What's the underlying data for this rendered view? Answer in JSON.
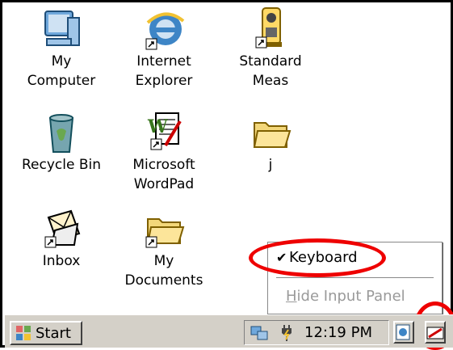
{
  "desktop": {
    "icons": [
      {
        "label": "My\nComputer"
      },
      {
        "label": "Internet\nExplorer"
      },
      {
        "label": "Standard\nMeas"
      },
      {
        "label": "Recycle Bin"
      },
      {
        "label": "Microsoft\nWordPad"
      },
      {
        "label": "j"
      },
      {
        "label": "Inbox"
      },
      {
        "label": "My\nDocuments"
      }
    ]
  },
  "input_menu": {
    "keyboard_label": "Keyboard",
    "keyboard_checked": true,
    "hide_label": "Hide Input Panel"
  },
  "taskbar": {
    "start_label": "Start",
    "clock": "12:19 PM"
  },
  "colors": {
    "annotation": "#e00000",
    "folder": "#f3d77a",
    "taskbar": "#d4d0c8"
  }
}
